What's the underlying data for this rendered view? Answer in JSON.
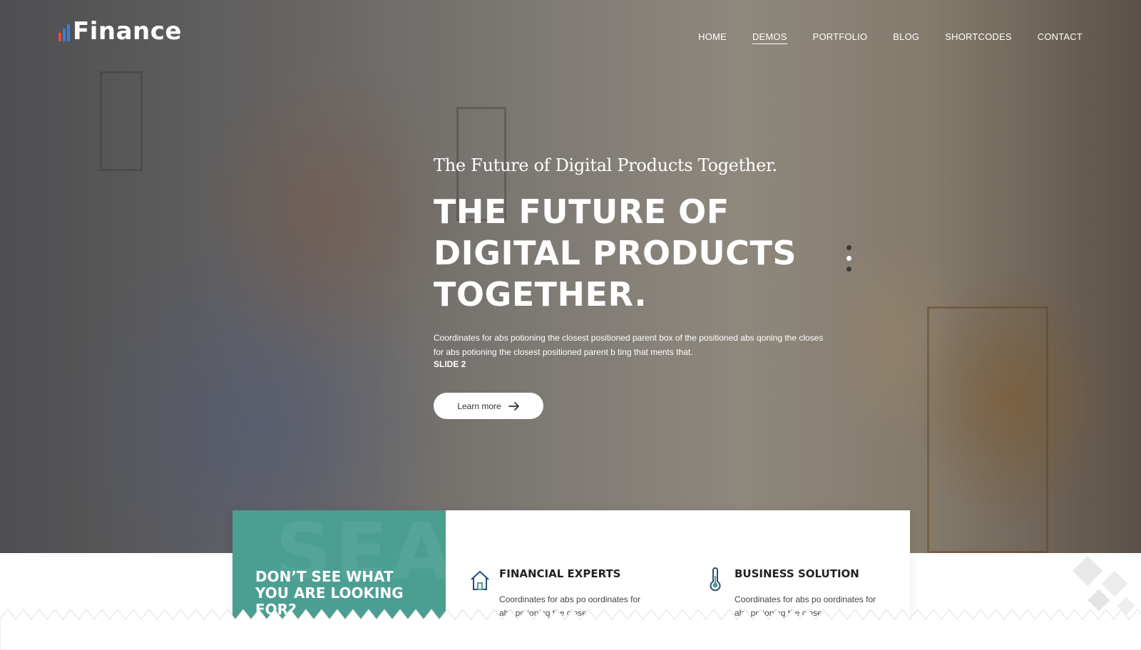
{
  "brand": {
    "logo_text": "Finance",
    "bar_colors": [
      "#e84c3d",
      "#3b7dd8",
      "#3b7dd8"
    ]
  },
  "nav": {
    "items": [
      "HOME",
      "DEMOS",
      "PORTFOLIO",
      "BLOG",
      "SHORTCODES",
      "CONTACT"
    ],
    "active": "DEMOS"
  },
  "hero": {
    "tagline": "The Future of Digital Products Together.",
    "headline_lines": [
      "THE FUTURE OF",
      "DIGITAL PRODUCTS",
      "TOGETHER."
    ],
    "description": "Coordinates for abs potioning the closest positioned parent box of the positioned abs qoning the closes for abs potioning the closest positioned parent b ting that ments that.",
    "slide_label": "SLIDE 2",
    "cta_label": "Learn more",
    "cta_icon": "arrow-right-icon",
    "slider_dots": 3,
    "active_dot": 2
  },
  "features": {
    "banner_title": "DON’T SEE WHAT YOU ARE LOOKING FOR?",
    "banner_watermark": "SEA",
    "items": [
      {
        "icon": "house-icon",
        "title": "FINANCIAL EXPERTS",
        "text": "Coordinates for abs po oordinates for abs potioning the closes"
      },
      {
        "icon": "thermometer-icon",
        "title": "BUSINESS SOLUTION",
        "text": "Coordinates for abs po oordinates for abs potioning the closes"
      }
    ]
  },
  "colors": {
    "accent_teal": "#4a9f91",
    "text_dark": "#222222",
    "icon_blue": "#2c4a7a"
  }
}
